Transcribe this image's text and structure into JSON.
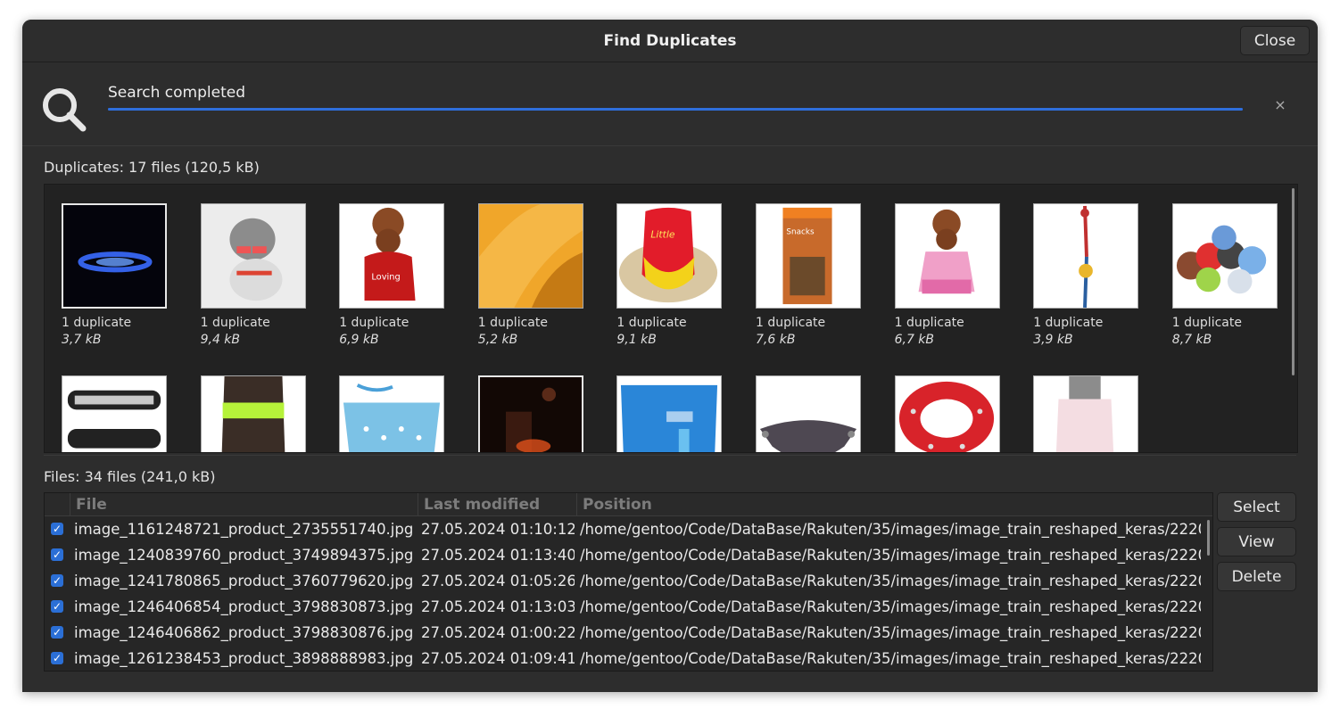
{
  "window": {
    "title": "Find Duplicates",
    "close_label": "Close"
  },
  "search": {
    "status": "Search completed",
    "progress": 1.0,
    "cancel_glyph": "×",
    "icon": "search-icon"
  },
  "duplicates": {
    "label": "Duplicates: 17 files (120,5 kB)",
    "items": [
      {
        "count": "1 duplicate",
        "size": "3,7 kB",
        "desc": "blue LED dog collar"
      },
      {
        "count": "1 duplicate",
        "size": "9,4 kB",
        "desc": "grey dog in striped shirt"
      },
      {
        "count": "1 duplicate",
        "size": "6,9 kB",
        "desc": "brown poodle in red shirt"
      },
      {
        "count": "1 duplicate",
        "size": "5,2 kB",
        "desc": "orange fabric"
      },
      {
        "count": "1 duplicate",
        "size": "9,1 kB",
        "desc": "red Little Devil dog shirt"
      },
      {
        "count": "1 duplicate",
        "size": "7,6 kB",
        "desc": "dog snacks pack"
      },
      {
        "count": "1 duplicate",
        "size": "6,7 kB",
        "desc": "poodle in pink dress"
      },
      {
        "count": "1 duplicate",
        "size": "3,9 kB",
        "desc": "rope dog toy"
      },
      {
        "count": "1 duplicate",
        "size": "8,7 kB",
        "desc": "rolled blankets"
      },
      {
        "desc": "rhinestone collar"
      },
      {
        "desc": "dog vest with green stripe"
      },
      {
        "desc": "blue dotted harness"
      },
      {
        "desc": "dark room scene"
      },
      {
        "desc": "blue vest"
      },
      {
        "desc": "grey hood"
      },
      {
        "desc": "red spiked collar"
      },
      {
        "desc": "white knit sweater"
      }
    ]
  },
  "files": {
    "label": "Files: 34 files (241,0 kB)",
    "columns": [
      "File",
      "Last modified",
      "Position"
    ],
    "rows": [
      {
        "checked": true,
        "file": "image_1161248721_product_2735551740.jpg",
        "modified": "27.05.2024 01:10:12",
        "position": "/home/gentoo/Code/DataBase/Rakuten/35/images/image_train_reshaped_keras/2220"
      },
      {
        "checked": true,
        "file": "image_1240839760_product_3749894375.jpg",
        "modified": "27.05.2024 01:13:40",
        "position": "/home/gentoo/Code/DataBase/Rakuten/35/images/image_train_reshaped_keras/2220"
      },
      {
        "checked": true,
        "file": "image_1241780865_product_3760779620.jpg",
        "modified": "27.05.2024 01:05:26",
        "position": "/home/gentoo/Code/DataBase/Rakuten/35/images/image_train_reshaped_keras/2220"
      },
      {
        "checked": true,
        "file": "image_1246406854_product_3798830873.jpg",
        "modified": "27.05.2024 01:13:03",
        "position": "/home/gentoo/Code/DataBase/Rakuten/35/images/image_train_reshaped_keras/2220"
      },
      {
        "checked": true,
        "file": "image_1246406862_product_3798830876.jpg",
        "modified": "27.05.2024 01:00:22",
        "position": "/home/gentoo/Code/DataBase/Rakuten/35/images/image_train_reshaped_keras/2220"
      },
      {
        "checked": true,
        "file": "image_1261238453_product_3898888983.jpg",
        "modified": "27.05.2024 01:09:41",
        "position": "/home/gentoo/Code/DataBase/Rakuten/35/images/image_train_reshaped_keras/2220"
      }
    ]
  },
  "actions": {
    "select": "Select",
    "view": "View",
    "delete": "Delete"
  },
  "colors": {
    "window_bg": "#2d2d2d",
    "accent": "#2b6fd6",
    "text": "#e8e8e8",
    "grid_bg": "#222222"
  }
}
